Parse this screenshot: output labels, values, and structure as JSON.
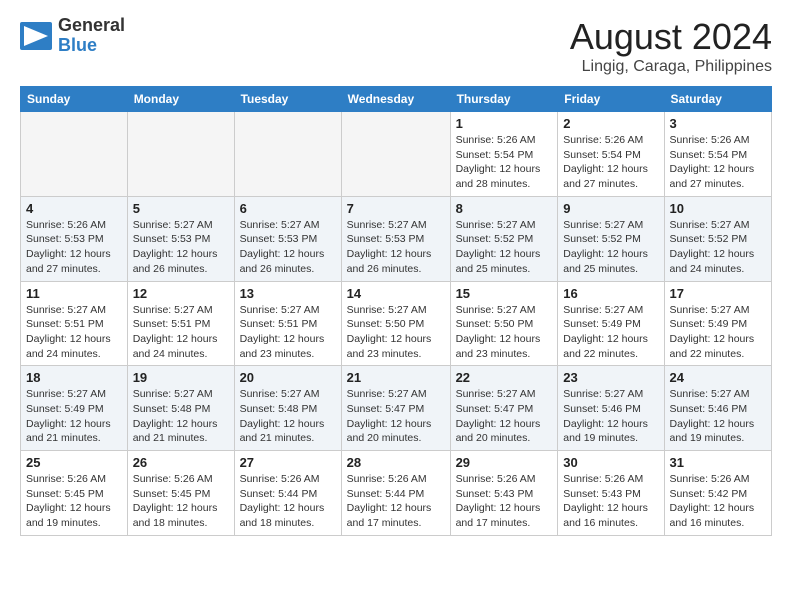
{
  "header": {
    "logo_general": "General",
    "logo_blue": "Blue",
    "month": "August 2024",
    "location": "Lingig, Caraga, Philippines"
  },
  "weekdays": [
    "Sunday",
    "Monday",
    "Tuesday",
    "Wednesday",
    "Thursday",
    "Friday",
    "Saturday"
  ],
  "weeks": [
    [
      {
        "day": "",
        "info": "",
        "empty": true
      },
      {
        "day": "",
        "info": "",
        "empty": true
      },
      {
        "day": "",
        "info": "",
        "empty": true
      },
      {
        "day": "",
        "info": "",
        "empty": true
      },
      {
        "day": "1",
        "info": "Sunrise: 5:26 AM\nSunset: 5:54 PM\nDaylight: 12 hours\nand 28 minutes.",
        "empty": false
      },
      {
        "day": "2",
        "info": "Sunrise: 5:26 AM\nSunset: 5:54 PM\nDaylight: 12 hours\nand 27 minutes.",
        "empty": false
      },
      {
        "day": "3",
        "info": "Sunrise: 5:26 AM\nSunset: 5:54 PM\nDaylight: 12 hours\nand 27 minutes.",
        "empty": false
      }
    ],
    [
      {
        "day": "4",
        "info": "Sunrise: 5:26 AM\nSunset: 5:53 PM\nDaylight: 12 hours\nand 27 minutes.",
        "empty": false
      },
      {
        "day": "5",
        "info": "Sunrise: 5:27 AM\nSunset: 5:53 PM\nDaylight: 12 hours\nand 26 minutes.",
        "empty": false
      },
      {
        "day": "6",
        "info": "Sunrise: 5:27 AM\nSunset: 5:53 PM\nDaylight: 12 hours\nand 26 minutes.",
        "empty": false
      },
      {
        "day": "7",
        "info": "Sunrise: 5:27 AM\nSunset: 5:53 PM\nDaylight: 12 hours\nand 26 minutes.",
        "empty": false
      },
      {
        "day": "8",
        "info": "Sunrise: 5:27 AM\nSunset: 5:52 PM\nDaylight: 12 hours\nand 25 minutes.",
        "empty": false
      },
      {
        "day": "9",
        "info": "Sunrise: 5:27 AM\nSunset: 5:52 PM\nDaylight: 12 hours\nand 25 minutes.",
        "empty": false
      },
      {
        "day": "10",
        "info": "Sunrise: 5:27 AM\nSunset: 5:52 PM\nDaylight: 12 hours\nand 24 minutes.",
        "empty": false
      }
    ],
    [
      {
        "day": "11",
        "info": "Sunrise: 5:27 AM\nSunset: 5:51 PM\nDaylight: 12 hours\nand 24 minutes.",
        "empty": false
      },
      {
        "day": "12",
        "info": "Sunrise: 5:27 AM\nSunset: 5:51 PM\nDaylight: 12 hours\nand 24 minutes.",
        "empty": false
      },
      {
        "day": "13",
        "info": "Sunrise: 5:27 AM\nSunset: 5:51 PM\nDaylight: 12 hours\nand 23 minutes.",
        "empty": false
      },
      {
        "day": "14",
        "info": "Sunrise: 5:27 AM\nSunset: 5:50 PM\nDaylight: 12 hours\nand 23 minutes.",
        "empty": false
      },
      {
        "day": "15",
        "info": "Sunrise: 5:27 AM\nSunset: 5:50 PM\nDaylight: 12 hours\nand 23 minutes.",
        "empty": false
      },
      {
        "day": "16",
        "info": "Sunrise: 5:27 AM\nSunset: 5:49 PM\nDaylight: 12 hours\nand 22 minutes.",
        "empty": false
      },
      {
        "day": "17",
        "info": "Sunrise: 5:27 AM\nSunset: 5:49 PM\nDaylight: 12 hours\nand 22 minutes.",
        "empty": false
      }
    ],
    [
      {
        "day": "18",
        "info": "Sunrise: 5:27 AM\nSunset: 5:49 PM\nDaylight: 12 hours\nand 21 minutes.",
        "empty": false
      },
      {
        "day": "19",
        "info": "Sunrise: 5:27 AM\nSunset: 5:48 PM\nDaylight: 12 hours\nand 21 minutes.",
        "empty": false
      },
      {
        "day": "20",
        "info": "Sunrise: 5:27 AM\nSunset: 5:48 PM\nDaylight: 12 hours\nand 21 minutes.",
        "empty": false
      },
      {
        "day": "21",
        "info": "Sunrise: 5:27 AM\nSunset: 5:47 PM\nDaylight: 12 hours\nand 20 minutes.",
        "empty": false
      },
      {
        "day": "22",
        "info": "Sunrise: 5:27 AM\nSunset: 5:47 PM\nDaylight: 12 hours\nand 20 minutes.",
        "empty": false
      },
      {
        "day": "23",
        "info": "Sunrise: 5:27 AM\nSunset: 5:46 PM\nDaylight: 12 hours\nand 19 minutes.",
        "empty": false
      },
      {
        "day": "24",
        "info": "Sunrise: 5:27 AM\nSunset: 5:46 PM\nDaylight: 12 hours\nand 19 minutes.",
        "empty": false
      }
    ],
    [
      {
        "day": "25",
        "info": "Sunrise: 5:26 AM\nSunset: 5:45 PM\nDaylight: 12 hours\nand 19 minutes.",
        "empty": false
      },
      {
        "day": "26",
        "info": "Sunrise: 5:26 AM\nSunset: 5:45 PM\nDaylight: 12 hours\nand 18 minutes.",
        "empty": false
      },
      {
        "day": "27",
        "info": "Sunrise: 5:26 AM\nSunset: 5:44 PM\nDaylight: 12 hours\nand 18 minutes.",
        "empty": false
      },
      {
        "day": "28",
        "info": "Sunrise: 5:26 AM\nSunset: 5:44 PM\nDaylight: 12 hours\nand 17 minutes.",
        "empty": false
      },
      {
        "day": "29",
        "info": "Sunrise: 5:26 AM\nSunset: 5:43 PM\nDaylight: 12 hours\nand 17 minutes.",
        "empty": false
      },
      {
        "day": "30",
        "info": "Sunrise: 5:26 AM\nSunset: 5:43 PM\nDaylight: 12 hours\nand 16 minutes.",
        "empty": false
      },
      {
        "day": "31",
        "info": "Sunrise: 5:26 AM\nSunset: 5:42 PM\nDaylight: 12 hours\nand 16 minutes.",
        "empty": false
      }
    ]
  ]
}
